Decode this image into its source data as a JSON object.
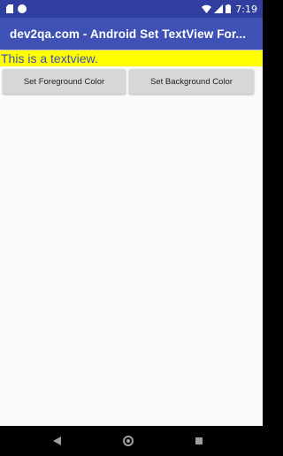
{
  "status_bar": {
    "time": "7:19",
    "icons": [
      "sd-card-icon",
      "circle-notification-icon",
      "wifi-icon",
      "signal-icon",
      "battery-icon"
    ]
  },
  "app_bar": {
    "title": "dev2qa.com - Android Set TextView For..."
  },
  "textview": {
    "text": "This is a textview.",
    "background_color": "#ffff00",
    "text_color": "#3f51b5"
  },
  "buttons": {
    "foreground_label": "Set Foreground Color",
    "background_label": "Set Background Color"
  },
  "nav_bar": {
    "icons": [
      "back-icon",
      "home-icon",
      "recents-icon"
    ]
  },
  "colors": {
    "primary": "#3f51b5",
    "primary_dark": "#303f9f",
    "button": "#d6d7d7"
  }
}
